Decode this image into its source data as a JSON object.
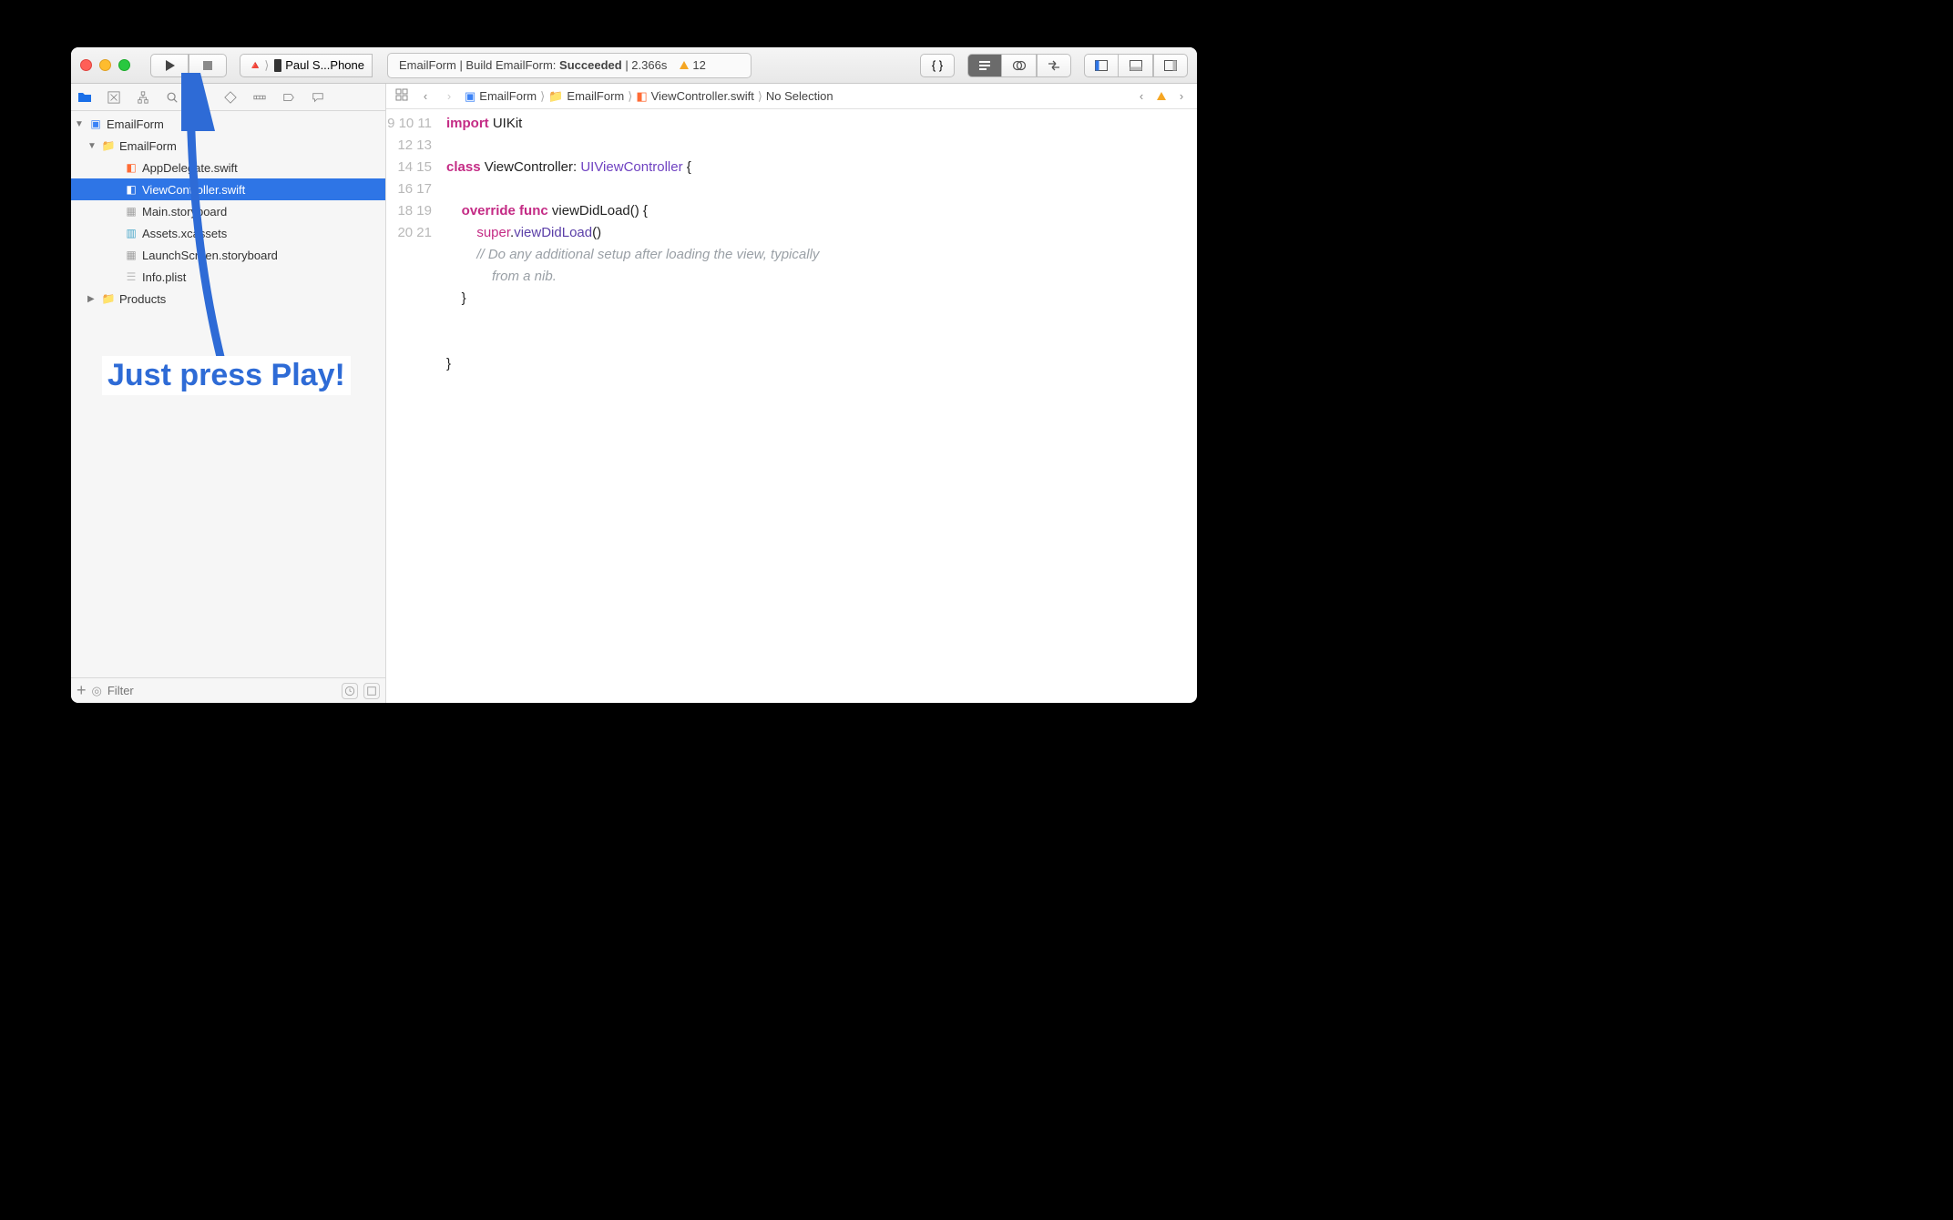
{
  "toolbar": {
    "scheme_label": "Paul S...Phone",
    "status_left": "EmailForm | Build EmailForm:",
    "status_result": "Succeeded",
    "status_time": "| 2.366s",
    "warning_count": "12"
  },
  "navigator": {
    "project": "EmailForm",
    "group": "EmailForm",
    "files": [
      "AppDelegate.swift",
      "ViewController.swift",
      "Main.storyboard",
      "Assets.xcassets",
      "LaunchScreen.storyboard",
      "Info.plist"
    ],
    "products": "Products",
    "filter_placeholder": "Filter"
  },
  "jumpbar": {
    "c1": "EmailForm",
    "c2": "EmailForm",
    "c3": "ViewController.swift",
    "c4": "No Selection"
  },
  "code": {
    "lines_start": 9,
    "lines_end": 21,
    "l9": "import UIKit",
    "l11_a": "class",
    "l11_b": "ViewController:",
    "l11_c": "UIViewController",
    "l11_d": "{",
    "l13_a": "override",
    "l13_b": "func",
    "l13_c": "viewDidLoad() {",
    "l14_a": "super",
    "l14_b": ".viewDidLoad()",
    "l15": "// Do any additional setup after loading the view, typically",
    "l15b": "from a nib.",
    "l16": "}",
    "l19": "}"
  },
  "annotation": "Just press Play!"
}
